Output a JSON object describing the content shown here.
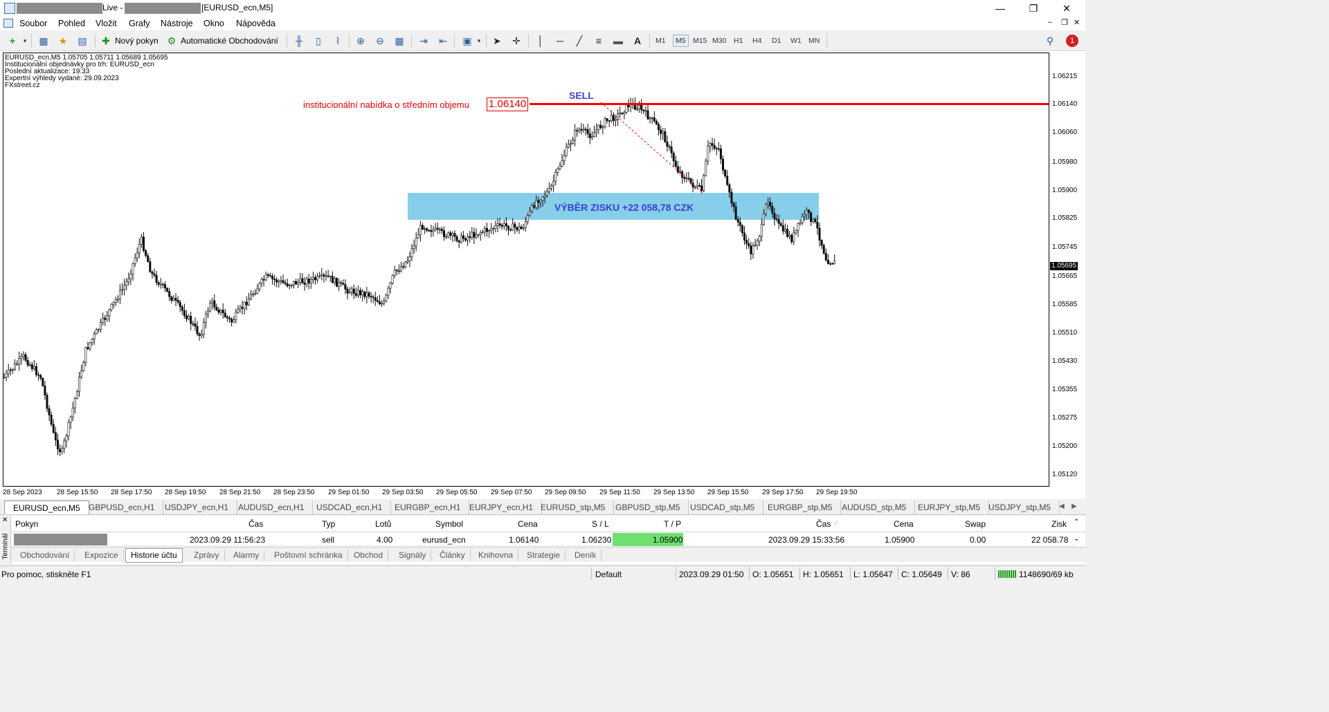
{
  "window": {
    "title_live": "Live - ",
    "title_chart": "[EURUSD_ecn,M5]",
    "minimize": "—",
    "maximize": "❐",
    "close": "✕"
  },
  "menu": [
    "Soubor",
    "Pohled",
    "Vložit",
    "Grafy",
    "Nástroje",
    "Okno",
    "Nápověda"
  ],
  "toolbar": {
    "new_order": "Nový pokyn",
    "auto_trading": "Automatické Obchodování",
    "timeframes": [
      "M1",
      "M5",
      "M15",
      "M30",
      "H1",
      "H4",
      "D1",
      "W1",
      "MN"
    ],
    "active_timeframe": "M5",
    "text_tool": "A",
    "notification_count": "1"
  },
  "chart": {
    "header": "EURUSD_ecn,M5  1.05705 1.05711 1.05689 1.05695",
    "info_lines": [
      "Institucionální objednávky pro trh: EURUSD_ecn",
      "Poslední aktualizace: 19:33",
      "Expertní výhledy vydané: 29.09.2023",
      "FXstreet.cz"
    ],
    "level_label": "institucionální nabídka o středním objemu",
    "level_price": "1.06140",
    "sell_label": "SELL",
    "profit_label": "VÝBĚR ZISKU +22 058,78 CZK",
    "current_price": "1.05695",
    "colors": {
      "level": "#ff0000",
      "profit_zone": "#87ceeb",
      "profit_text": "#3a3fcf",
      "sell_text": "#3a3fcf",
      "candle": "#0a0a0a"
    },
    "price_ticks": [
      "1.06215",
      "1.06140",
      "1.06060",
      "1.05980",
      "1.05900",
      "1.05825",
      "1.05745",
      "1.05665",
      "1.05585",
      "1.05510",
      "1.05430",
      "1.05355",
      "1.05275",
      "1.05200",
      "1.05120"
    ],
    "time_ticks": [
      "28 Sep 2023",
      "28 Sep 15:50",
      "28 Sep 17:50",
      "28 Sep 19:50",
      "28 Sep 21:50",
      "28 Sep 23:50",
      "29 Sep 01:50",
      "29 Sep 03:50",
      "29 Sep 05:50",
      "29 Sep 07:50",
      "29 Sep 09:50",
      "29 Sep 11:50",
      "29 Sep 13:50",
      "29 Sep 15:50",
      "29 Sep 17:50",
      "29 Sep 19:50"
    ]
  },
  "symbol_tabs": [
    "EURUSD_ecn,M5",
    "GBPUSD_ecn,H1",
    "USDJPY_ecn,H1",
    "AUDUSD_ecn,H1",
    "USDCAD_ecn,H1",
    "EURGBP_ecn,H1",
    "EURJPY_ecn,H1",
    "EURUSD_stp,M5",
    "GBPUSD_stp,M5",
    "USDCAD_stp,M5",
    "EURGBP_stp,M5",
    "AUDUSD_stp,M5",
    "EURJPY_stp,M5",
    "USDJPY_stp,M5"
  ],
  "terminal": {
    "side_label": "Terminál",
    "headers": [
      "Pokyn",
      "Čas",
      "Typ",
      "Lotů",
      "Symbol",
      "Cena",
      "S / L",
      "T / P",
      "Čas",
      "Cena",
      "Swap",
      "Zisk"
    ],
    "row": {
      "open_time": "2023.09.29 11:56:23",
      "type": "sell",
      "lots": "4.00",
      "symbol": "eurusd_ecn",
      "open_price": "1.06140",
      "sl": "1.06230",
      "tp": "1.05900",
      "close_time": "2023.09.29 15:33:56",
      "close_price": "1.05900",
      "swap": "0.00",
      "profit": "22 058.78"
    },
    "tabs": [
      "Obchodování",
      "Expozice",
      "Historie účtu",
      "Zprávy",
      "Alarmy",
      "Poštovní schránka",
      "Obchod",
      "Signály",
      "Články",
      "Knihovna",
      "Strategie",
      "Deník"
    ],
    "active_tab": "Historie účtu"
  },
  "status": {
    "help": "Pro pomoc, stiskněte F1",
    "profile": "Default",
    "datetime": "2023.09.29 01:50",
    "open": "O: 1.05651",
    "high": "H: 1.05651",
    "low": "L: 1.05647",
    "close": "C: 1.05649",
    "volume": "V: 86",
    "traffic": "1148690/69 kb"
  }
}
